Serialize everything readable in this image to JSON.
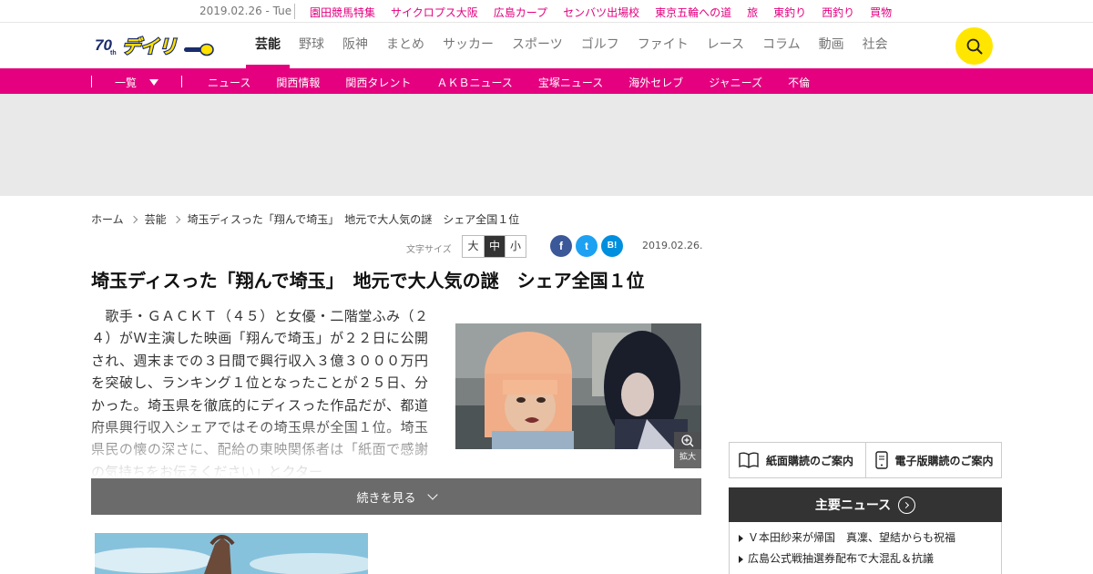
{
  "topstrip": {
    "date": "2019.02.26 - Tue",
    "links": [
      "園田競馬特集",
      "サイクロプス大阪",
      "広島カープ",
      "センバツ出場校",
      "東京五輪への道",
      "旅",
      "東釣り",
      "西釣り",
      "買物"
    ]
  },
  "header": {
    "logo_text": "デイリー",
    "logo_badge": "70th",
    "nav": [
      "芸能",
      "野球",
      "阪神",
      "まとめ",
      "サッカー",
      "スポーツ",
      "ゴルフ",
      "ファイト",
      "レース",
      "コラム",
      "動画",
      "社会"
    ],
    "active_nav": "芸能"
  },
  "subnav": {
    "all_label": "一覧",
    "items": [
      "ニュース",
      "関西情報",
      "関西タレント",
      "ＡＫＢニュース",
      "宝塚ニュース",
      "海外セレブ",
      "ジャニーズ",
      "不倫"
    ]
  },
  "breadcrumb": [
    "ホーム",
    "芸能",
    "埼玉ディスった「翔んで埼玉」　地元で大人気の謎　シェア全国１位"
  ],
  "tools": {
    "fontsize_label": "文字サイズ",
    "sizes": [
      "大",
      "中",
      "小"
    ],
    "active_size": "中",
    "share": {
      "facebook": "f",
      "twitter": "t",
      "hatena": "B!"
    },
    "date": "2019.02.26."
  },
  "article": {
    "headline": "埼玉ディスった「翔んで埼玉」　地元で大人気の謎　シェア全国１位",
    "body": "　歌手・ＧＡＣＫＴ（４５）と女優・二階堂ふみ（２４）がＷ主演した映画「翔んで埼玉」が２２日に公開され、週末までの３日間で興行収入３億３０００万円を突破し、ランキング１位となったことが２５日、分かった。埼玉県を徹底的にディスった作品だが、都道府県興行収入シェアではその埼玉県が全国１位。埼玉県民の懐の深さに、配給の東映関係者は「紙面で感謝の気持ちをお伝えください」とクター",
    "zoom_label": "拡大",
    "more_label": "続きを見る"
  },
  "sidebar": {
    "print_sub": "紙面購読のご案内",
    "digital_sub": "電子版購読のご案内",
    "major_news_title": "主要ニュース",
    "news": [
      "Ｖ本田紗来が帰国　真凜、望結からも祝福",
      "広島公式戦抽選券配布で大混乱＆抗議"
    ]
  },
  "colors": {
    "brand_pink": "#e4007f",
    "search_yellow": "#ffe600",
    "logo_yellow": "#ffe100"
  }
}
